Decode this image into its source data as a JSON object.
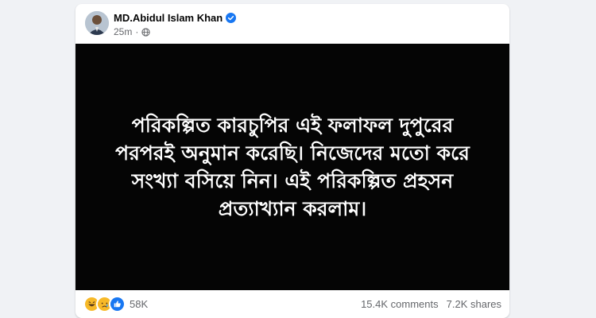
{
  "post": {
    "author": "MD.Abidul Islam Khan",
    "time": "25m",
    "text": "পরিকল্পিত কারচুপির এই ফলাফল দুপুরের পরপরই অনুমান করেছি। নিজেদের মতো করে সংখ্যা বসিয়ে নিন। এই পরিকল্পিত প্রহসন প্রত্যাখ্যান করলাম।",
    "reactions_count": "58K",
    "comments": "15.4K comments",
    "shares": "7.2K shares",
    "reaction_icons": [
      "haha-icon",
      "sad-icon",
      "like-icon"
    ]
  },
  "colors": {
    "background": "#f0f2f5",
    "media_bg": "#050505",
    "verified": "#1877f2",
    "meta_text": "#65676b"
  }
}
